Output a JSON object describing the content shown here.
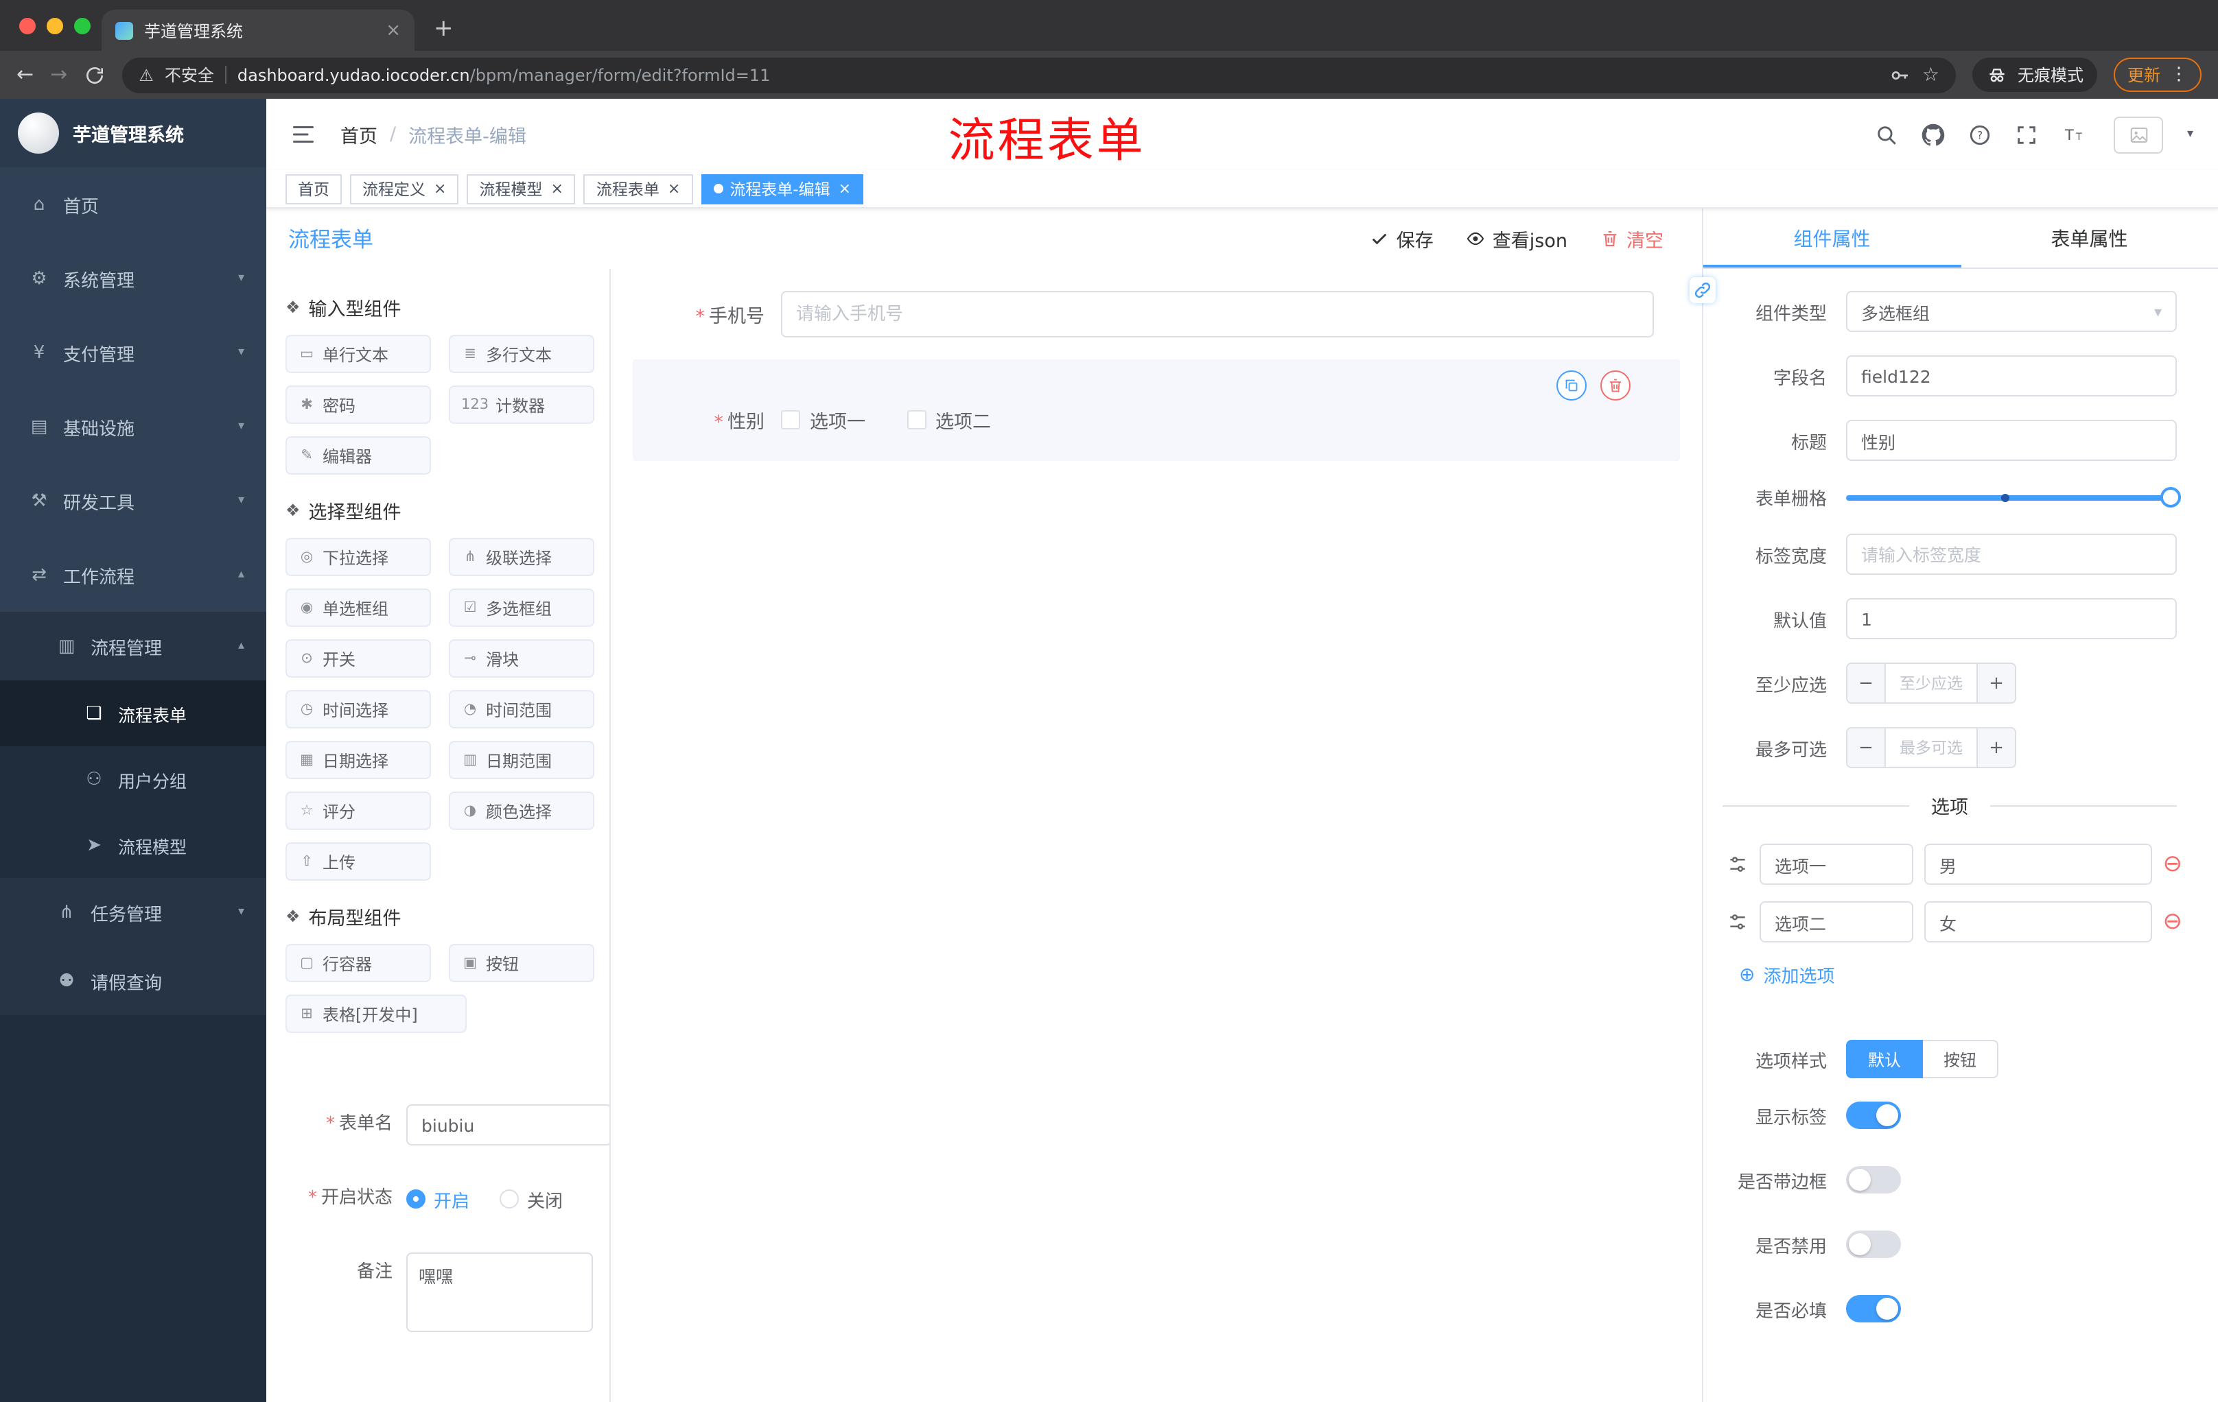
{
  "colors": {
    "accent": "#409eff",
    "danger": "#f56c6c",
    "annotation_red": "#fb0f0f",
    "sidebar_bg": "#304156",
    "update_orange": "#e8710a"
  },
  "browser": {
    "tab_title": "芋道管理系统",
    "security": "不安全",
    "url_domain": "dashboard.yudao.iocoder.cn",
    "url_path": "/bpm/manager/form/edit?formId=11",
    "incognito_label": "无痕模式",
    "update_label": "更新"
  },
  "sidebar": {
    "logo_title": "芋道管理系统",
    "items": [
      {
        "label": "首页",
        "icon": "home",
        "level": 1
      },
      {
        "label": "系统管理",
        "icon": "gear",
        "level": 1,
        "arrow": "down"
      },
      {
        "label": "支付管理",
        "icon": "yen",
        "level": 1,
        "arrow": "down"
      },
      {
        "label": "基础设施",
        "icon": "infra",
        "level": 1,
        "arrow": "down"
      },
      {
        "label": "研发工具",
        "icon": "tools",
        "level": 1,
        "arrow": "down"
      },
      {
        "label": "工作流程",
        "icon": "workflow",
        "level": 1,
        "arrow": "up"
      },
      {
        "label": "流程管理",
        "icon": "process",
        "level": 2,
        "arrow": "up"
      },
      {
        "label": "流程表单",
        "icon": "form-doc",
        "level": 3,
        "active": true
      },
      {
        "label": "用户分组",
        "icon": "user-group",
        "level": 3
      },
      {
        "label": "流程模型",
        "icon": "model",
        "level": 3
      },
      {
        "label": "任务管理",
        "icon": "task",
        "level": 2,
        "arrow": "down"
      },
      {
        "label": "请假查询",
        "icon": "leave",
        "level": 2
      }
    ]
  },
  "header": {
    "breadcrumb_home": "首页",
    "breadcrumb_sep": "/",
    "breadcrumb_current": "流程表单-编辑",
    "annotation": "流程表单"
  },
  "tags": [
    {
      "label": "首页"
    },
    {
      "label": "流程定义",
      "closable": true
    },
    {
      "label": "流程模型",
      "closable": true
    },
    {
      "label": "流程表单",
      "closable": true
    },
    {
      "label": "流程表单-编辑",
      "closable": true,
      "active": true
    }
  ],
  "builder": {
    "title": "流程表单",
    "actions": {
      "save": "保存",
      "view_json": "查看json",
      "clear": "清空"
    },
    "sections": [
      {
        "title": "输入型组件",
        "items": [
          {
            "label": "单行文本",
            "icon": "text-field"
          },
          {
            "label": "多行文本",
            "icon": "textarea-lines"
          },
          {
            "label": "密码",
            "icon": "password"
          },
          {
            "label": "计数器",
            "icon": "counter"
          },
          {
            "label": "编辑器",
            "icon": "editor"
          }
        ]
      },
      {
        "title": "选择型组件",
        "items": [
          {
            "label": "下拉选择",
            "icon": "select"
          },
          {
            "label": "级联选择",
            "icon": "cascader"
          },
          {
            "label": "单选框组",
            "icon": "radio"
          },
          {
            "label": "多选框组",
            "icon": "checkbox"
          },
          {
            "label": "开关",
            "icon": "switch"
          },
          {
            "label": "滑块",
            "icon": "slider"
          },
          {
            "label": "时间选择",
            "icon": "time"
          },
          {
            "label": "时间范围",
            "icon": "time-range"
          },
          {
            "label": "日期选择",
            "icon": "date"
          },
          {
            "label": "日期范围",
            "icon": "date-range"
          },
          {
            "label": "评分",
            "icon": "rate"
          },
          {
            "label": "颜色选择",
            "icon": "color"
          },
          {
            "label": "上传",
            "icon": "upload"
          }
        ]
      },
      {
        "title": "布局型组件",
        "items": [
          {
            "label": "行容器",
            "icon": "row"
          },
          {
            "label": "按钮",
            "icon": "button"
          },
          {
            "label": "表格[开发中]",
            "icon": "table",
            "wide": true
          }
        ]
      }
    ],
    "form": {
      "name_label": "表单名",
      "name_value": "biubiu",
      "status_label": "开启状态",
      "status_on": "开启",
      "status_off": "关闭",
      "remark_label": "备注",
      "remark_value": "嘿嘿"
    },
    "canvas": {
      "phone_label": "手机号",
      "phone_placeholder": "请输入手机号",
      "gender_label": "性别",
      "gender_options": [
        "选项一",
        "选项二"
      ]
    }
  },
  "props": {
    "tabs": [
      "组件属性",
      "表单属性"
    ],
    "rows": {
      "type_label": "组件类型",
      "type_value": "多选框组",
      "field_label": "字段名",
      "field_value": "field122",
      "title_label": "标题",
      "title_value": "性别",
      "grid_label": "表单栅格",
      "width_label": "标签宽度",
      "width_placeholder": "请输入标签宽度",
      "default_label": "默认值",
      "default_value": "1",
      "min_label": "至少应选",
      "min_placeholder": "至少应选",
      "max_label": "最多可选",
      "max_placeholder": "最多可选"
    },
    "divider": "选项",
    "options": [
      {
        "label": "选项一",
        "value": "男"
      },
      {
        "label": "选项二",
        "value": "女"
      }
    ],
    "add_option": "添加选项",
    "style": {
      "label": "选项样式",
      "options": [
        "默认",
        "按钮"
      ],
      "active": 0
    },
    "switches": [
      {
        "label": "显示标签",
        "on": true
      },
      {
        "label": "是否带边框",
        "on": false
      },
      {
        "label": "是否禁用",
        "on": false
      },
      {
        "label": "是否必填",
        "on": true
      }
    ]
  }
}
